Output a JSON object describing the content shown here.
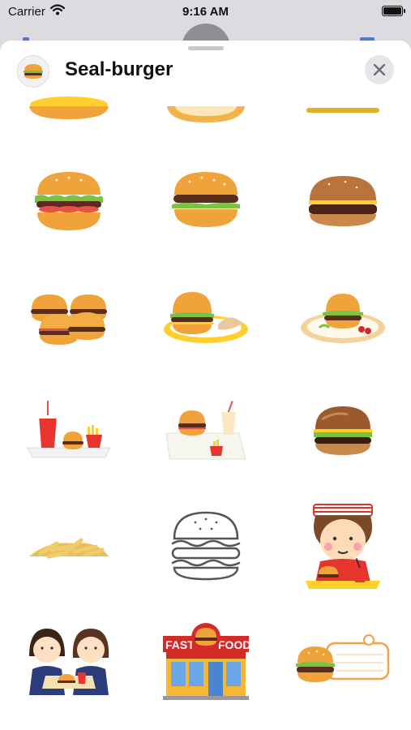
{
  "status_bar": {
    "carrier": "Carrier",
    "time": "9:16 AM"
  },
  "sheet": {
    "title": "Seal-burger",
    "app_icon": "burger-icon",
    "close_icon": "close-icon"
  },
  "stickers": [
    {
      "icon": "burger-bun-bottom-icon"
    },
    {
      "icon": "plate-rim-icon"
    },
    {
      "icon": "bun-edge-icon"
    },
    {
      "icon": "lettuce-tomato-burger-icon"
    },
    {
      "icon": "cheeseburger-icon"
    },
    {
      "icon": "realistic-burger-icon"
    },
    {
      "icon": "burger-stack-icon"
    },
    {
      "icon": "burger-plate-bread-icon"
    },
    {
      "icon": "burger-plate-cherries-icon"
    },
    {
      "icon": "drink-burger-fries-tray-icon"
    },
    {
      "icon": "burger-fries-shake-tray-icon"
    },
    {
      "icon": "photo-burger-icon"
    },
    {
      "icon": "french-fries-icon"
    },
    {
      "icon": "burger-outline-icon"
    },
    {
      "icon": "boy-eating-burger-icon"
    },
    {
      "icon": "students-eating-icon"
    },
    {
      "icon": "fast-food-shop-icon"
    },
    {
      "icon": "burger-memo-frame-icon"
    }
  ],
  "shop_sign": {
    "left": "FAST",
    "right": "FOOD"
  },
  "colors": {
    "bun": "#f0a33a",
    "bun_shade": "#d97f1f",
    "lettuce": "#7cc242",
    "tomato": "#e8504a",
    "patty": "#5a2d1a",
    "cheese": "#ffcf2e",
    "sesame": "#fff6dc"
  }
}
